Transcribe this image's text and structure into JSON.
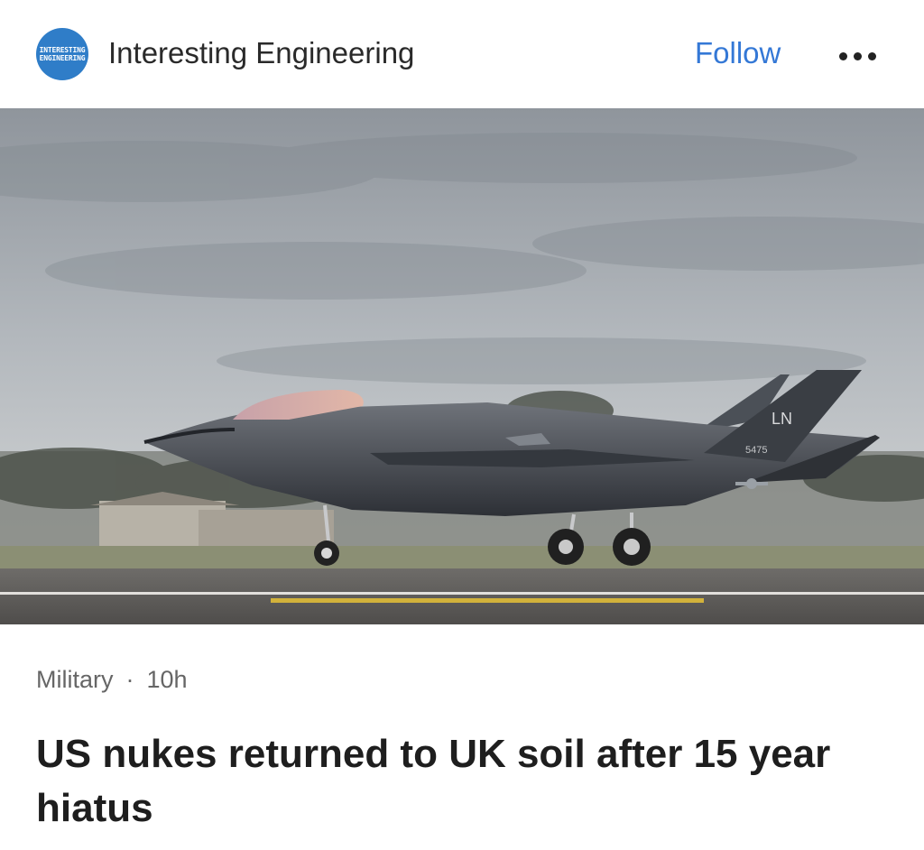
{
  "header": {
    "logo_text_line1": "INTERESTING",
    "logo_text_line2": "ENGINEERING",
    "source_name": "Interesting Engineering",
    "follow_label": "Follow",
    "more_icon": "more-horizontal-icon"
  },
  "image": {
    "description_icon": "photo",
    "tail_code": "LN",
    "tail_number": "5475"
  },
  "article": {
    "category": "Military",
    "separator": "·",
    "time": "10h",
    "headline": "US nukes returned to UK soil after 15 year hiatus"
  },
  "colors": {
    "accent": "#3478d6",
    "logo": "#2f7dc8"
  }
}
